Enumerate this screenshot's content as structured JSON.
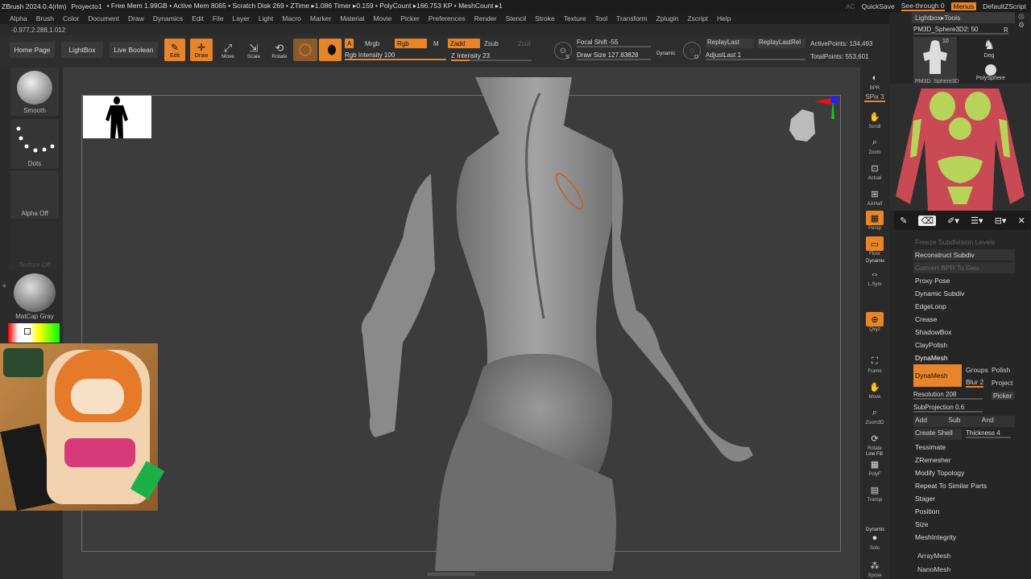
{
  "titlebar": {
    "app": "ZBrush 2024.0.4(rlm)",
    "project": "Proyecto1",
    "stats": "• Free Mem 1.99GB • Active Mem 8065 • Scratch Disk 269 • ZTime ▸1.086 Timer ▸0.159 • PolyCount ▸166.753 KP • MeshCount ▸1",
    "ac": "AC",
    "quicksave": "QuickSave",
    "seethrough": "See-through 0",
    "menus": "Menus",
    "script": "DefaultZScript"
  },
  "menubar": [
    "Alpha",
    "Brush",
    "Color",
    "Document",
    "Draw",
    "Dynamics",
    "Edit",
    "File",
    "Layer",
    "Light",
    "Macro",
    "Marker",
    "Material",
    "Movie",
    "Picker",
    "Preferences",
    "Render",
    "Stencil",
    "Stroke",
    "Texture",
    "Tool",
    "Transform",
    "Zplugin",
    "Zscript",
    "Help"
  ],
  "coords": "-0.977,2.288,1.012",
  "shelf": {
    "home": "Home Page",
    "lightbox": "LightBox",
    "liveboolean": "Live Boolean",
    "edit": "Edit",
    "draw": "Draw",
    "move": "Move",
    "scale": "Scale",
    "rotate": "Rotate",
    "a": "A",
    "mrgb": "Mrgb",
    "rgb": "Rgb",
    "m": "M",
    "zadd": "Zadd",
    "zsub": "Zsub",
    "zcut": "Zcut",
    "rgb_intensity": "Rgb Intensity 100",
    "z_intensity": "Z Intensity 23",
    "focal_shift": "Focal Shift -55",
    "draw_size": "Draw Size 127.83828",
    "dynamic": "Dynamic",
    "replaylast": "ReplayLast",
    "replaylastrel": "ReplayLastRel",
    "adjustlast": "AdjustLast 1",
    "activepoints": "ActivePoints: 134,493",
    "totalpoints": "TotalPoints: 553,601",
    "s": "S",
    "d": "D",
    "rgb_intensity_value": 1.0,
    "z_intensity_value": 0.23
  },
  "left": {
    "smooth": "Smooth",
    "dots": "Dots",
    "alpha_off": "Alpha Off",
    "texture_off": "Texture Off",
    "matcap": "MatCap Gray"
  },
  "rightstrip": {
    "bpr": "BPR",
    "spix": "SPix 3",
    "scroll": "Scroll",
    "zoom": "Zoom",
    "actual": "Actual",
    "aahalf": "AAHalf",
    "persp": "Persp",
    "floor": "Floor",
    "dynamic": "Dynamic",
    "lsym": "L.Sym",
    "xyz": "Qxyz",
    "frame": "Frame",
    "move": "Move",
    "zoom3d": "Zoom3D",
    "rotate": "Rotate",
    "linefill": "Line Fill",
    "polyf": "PolyF",
    "transp": "Transp",
    "dynamic2": "Dynamic",
    "solo": "Solo",
    "xpose": "Xpose"
  },
  "panel": {
    "lightbox_tools": "Lightbox▸Tools",
    "current_tool": "PM3D_Sphere3D2: 50",
    "r": "R",
    "thumb1_count": "10",
    "thumb1_label": "PM3D_Sphere3D",
    "thumb2_label": "Dog",
    "thumb3_label": "PolySphere",
    "items": [
      {
        "label": "Freeze Subdivision Levels",
        "dim": true
      },
      {
        "label": "Reconstruct Subdiv",
        "dim": false
      },
      {
        "label": "Convert BPR To Geo",
        "dim": true
      },
      {
        "label": "Proxy Pose",
        "dim": false
      },
      {
        "label": "Dynamic Subdiv",
        "dim": false
      },
      {
        "label": "EdgeLoop",
        "dim": false
      },
      {
        "label": "Crease",
        "dim": false
      },
      {
        "label": "ShadowBox",
        "dim": false
      },
      {
        "label": "ClayPolish",
        "dim": false
      },
      {
        "label": "DynaMesh",
        "dim": false
      }
    ],
    "dynamesh_btn": "DynaMesh",
    "groups": "Groups",
    "polish": "Polish",
    "blur": "Blur 2",
    "project": "Project",
    "resolution": "Resolution 208",
    "picker": "Picker",
    "subprojection": "SubProjection 0.6",
    "add": "Add",
    "sub": "Sub",
    "and": "And",
    "create_shell": "Create Shell",
    "thickness": "Thickness 4",
    "items2": [
      "Tessimate",
      "ZRemesher",
      "Modify Topology",
      "Repeat To Similar Parts",
      "Stager",
      "Position",
      "Size",
      "MeshIntegrity"
    ],
    "arraymesh": "ArrayMesh",
    "nanomesh": "NanoMesh"
  },
  "pen_toolbar": [
    "pen-icon",
    "eraser-icon",
    "highlighter-icon",
    "menu-icon",
    "layout-icon",
    "close-icon"
  ],
  "colors": {
    "accent": "#e8842a",
    "bg": "#2a2a2a",
    "viewport": "#3c3c3c",
    "model": "#8a8a8a"
  }
}
